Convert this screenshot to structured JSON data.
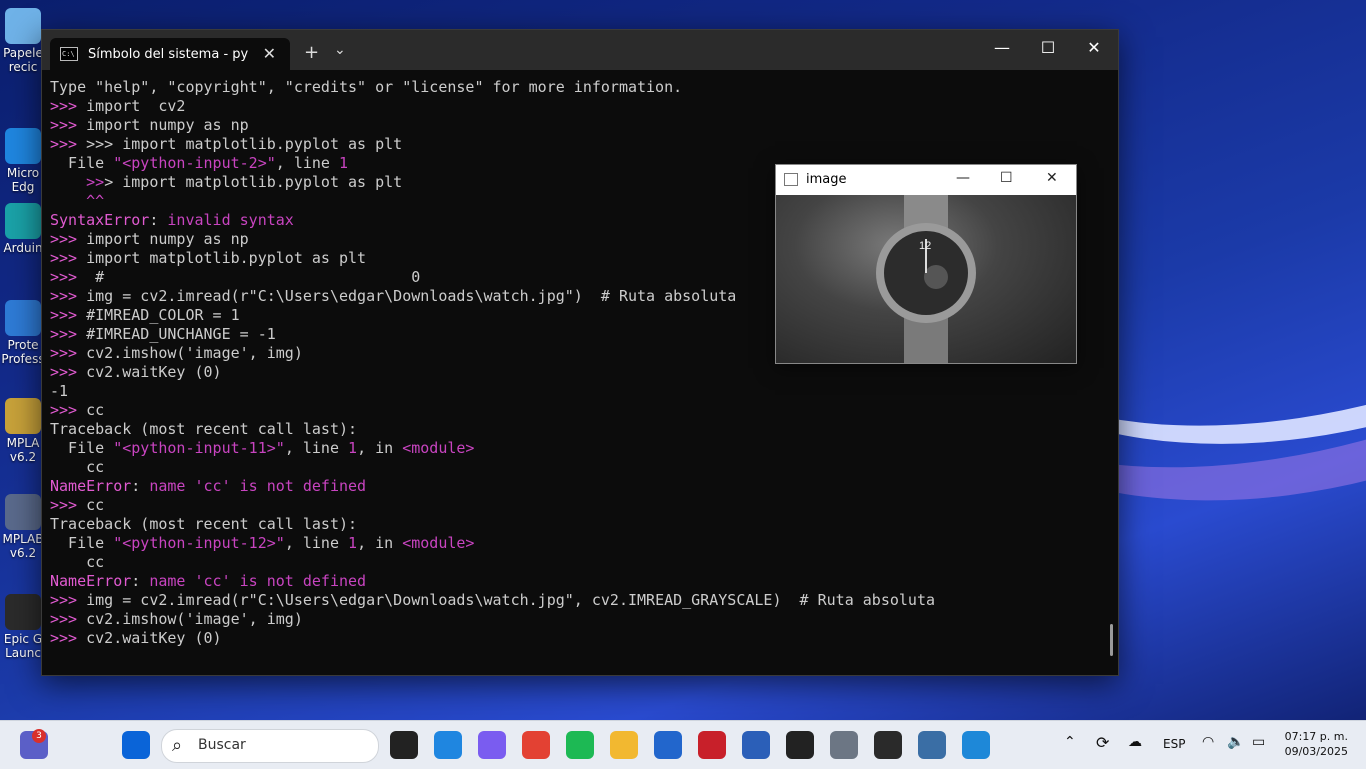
{
  "desktop": {
    "icons": [
      {
        "label": "Papele recic",
        "color": "#6fb2e8"
      },
      {
        "label": "Micro Edg",
        "color": "#1f86e0"
      },
      {
        "label": "Arduin",
        "color": "#1aa2a8"
      },
      {
        "label": "Prote Profess",
        "color": "#2e7bd6"
      },
      {
        "label": "MPLA v6.2",
        "color": "#c8a23a"
      },
      {
        "label": "MPLAB v6.2",
        "color": "#5a6a8c"
      },
      {
        "label": "Epic G Launc",
        "color": "#2b2b2b"
      }
    ]
  },
  "terminal": {
    "tab_title": "Símbolo del sistema - py",
    "lines": [
      [
        {
          "t": "Type \"help\", \"copyright\", \"credits\" or \"license\" for more information.",
          "c": ""
        }
      ],
      [
        {
          "t": ">>> ",
          "c": "p"
        },
        {
          "t": "import  cv2",
          "c": ""
        }
      ],
      [
        {
          "t": ">>> ",
          "c": "p"
        },
        {
          "t": "import numpy as np",
          "c": ""
        }
      ],
      [
        {
          "t": ">>> ",
          "c": "p"
        },
        {
          "t": ">>> import matplotlib.pyplot as plt",
          "c": ""
        }
      ],
      [
        {
          "t": "  File ",
          "c": ""
        },
        {
          "t": "\"<python-input-2>\"",
          "c": "m"
        },
        {
          "t": ", line ",
          "c": ""
        },
        {
          "t": "1",
          "c": "m"
        }
      ],
      [
        {
          "t": "    ",
          "c": ""
        },
        {
          "t": ">>",
          "c": "m"
        },
        {
          "t": "> import matplotlib.pyplot as plt",
          "c": ""
        }
      ],
      [
        {
          "t": "    ^^",
          "c": "m"
        }
      ],
      [
        {
          "t": "SyntaxError",
          "c": "err"
        },
        {
          "t": ": ",
          "c": ""
        },
        {
          "t": "invalid syntax",
          "c": "m"
        }
      ],
      [
        {
          "t": ">>> ",
          "c": "p"
        },
        {
          "t": "import numpy as np",
          "c": ""
        }
      ],
      [
        {
          "t": ">>> ",
          "c": "p"
        },
        {
          "t": "import matplotlib.pyplot as plt",
          "c": ""
        }
      ],
      [
        {
          "t": ">>> ",
          "c": "p"
        },
        {
          "t": " #                                  0",
          "c": ""
        }
      ],
      [
        {
          "t": ">>> ",
          "c": "p"
        },
        {
          "t": "img = cv2.imread(r\"C:\\Users\\edgar\\Downloads\\watch.jpg\")  # Ruta absoluta",
          "c": ""
        }
      ],
      [
        {
          "t": ">>> ",
          "c": "p"
        },
        {
          "t": "#IMREAD_COLOR = 1",
          "c": ""
        }
      ],
      [
        {
          "t": ">>> ",
          "c": "p"
        },
        {
          "t": "#IMREAD_UNCHANGE = -1",
          "c": ""
        }
      ],
      [
        {
          "t": ">>> ",
          "c": "p"
        },
        {
          "t": "cv2.imshow('image', img)",
          "c": ""
        }
      ],
      [
        {
          "t": ">>> ",
          "c": "p"
        },
        {
          "t": "cv2.waitKey (0)",
          "c": ""
        }
      ],
      [
        {
          "t": "-1",
          "c": ""
        }
      ],
      [
        {
          "t": ">>> ",
          "c": "p"
        },
        {
          "t": "cc",
          "c": ""
        }
      ],
      [
        {
          "t": "Traceback (most recent call last):",
          "c": ""
        }
      ],
      [
        {
          "t": "  File ",
          "c": ""
        },
        {
          "t": "\"<python-input-11>\"",
          "c": "m"
        },
        {
          "t": ", line ",
          "c": ""
        },
        {
          "t": "1",
          "c": "m"
        },
        {
          "t": ", in ",
          "c": ""
        },
        {
          "t": "<module>",
          "c": "m"
        }
      ],
      [
        {
          "t": "    cc",
          "c": ""
        }
      ],
      [
        {
          "t": "NameError",
          "c": "err"
        },
        {
          "t": ": ",
          "c": ""
        },
        {
          "t": "name 'cc' is not defined",
          "c": "m"
        }
      ],
      [
        {
          "t": ">>> ",
          "c": "p"
        },
        {
          "t": "cc",
          "c": ""
        }
      ],
      [
        {
          "t": "Traceback (most recent call last):",
          "c": ""
        }
      ],
      [
        {
          "t": "  File ",
          "c": ""
        },
        {
          "t": "\"<python-input-12>\"",
          "c": "m"
        },
        {
          "t": ", line ",
          "c": ""
        },
        {
          "t": "1",
          "c": "m"
        },
        {
          "t": ", in ",
          "c": ""
        },
        {
          "t": "<module>",
          "c": "m"
        }
      ],
      [
        {
          "t": "    cc",
          "c": ""
        }
      ],
      [
        {
          "t": "NameError",
          "c": "err"
        },
        {
          "t": ": ",
          "c": ""
        },
        {
          "t": "name 'cc' is not defined",
          "c": "m"
        }
      ],
      [
        {
          "t": ">>> ",
          "c": "p"
        },
        {
          "t": "img = cv2.imread(r\"C:\\Users\\edgar\\Downloads\\watch.jpg\", cv2.IMREAD_GRAYSCALE)  # Ruta absoluta",
          "c": ""
        }
      ],
      [
        {
          "t": ">>> ",
          "c": "p"
        },
        {
          "t": "cv2.imshow('image', img)",
          "c": ""
        }
      ],
      [
        {
          "t": ">>> ",
          "c": "p"
        },
        {
          "t": "cv2.waitKey (0)",
          "c": ""
        }
      ]
    ]
  },
  "image_window": {
    "title": "image",
    "watch_digit": "12"
  },
  "taskbar": {
    "search_placeholder": "Buscar",
    "notification_badge": "3",
    "language": "ESP",
    "time": "07:17 p. m.",
    "date": "09/03/2025",
    "apps": [
      {
        "name": "teams",
        "color": "#5b5fc7"
      },
      {
        "name": "start",
        "color": "#0a64d8"
      },
      {
        "name": "widgets",
        "color": "#e0a030"
      },
      {
        "name": "task-view",
        "color": "#222222"
      },
      {
        "name": "edge",
        "color": "#1f86e0"
      },
      {
        "name": "copilot",
        "color": "#7a5cf0"
      },
      {
        "name": "chrome",
        "color": "#e34133"
      },
      {
        "name": "spotify",
        "color": "#1db954"
      },
      {
        "name": "explorer",
        "color": "#f2b830"
      },
      {
        "name": "store",
        "color": "#2266cc"
      },
      {
        "name": "mcafee",
        "color": "#c8202a"
      },
      {
        "name": "word",
        "color": "#2b5fb8"
      },
      {
        "name": "chatgpt",
        "color": "#222222"
      },
      {
        "name": "settings",
        "color": "#6c7684"
      },
      {
        "name": "terminal",
        "color": "#2a2a2a"
      },
      {
        "name": "python",
        "color": "#3a6ea5"
      },
      {
        "name": "vscode",
        "color": "#1e88d8"
      }
    ]
  }
}
